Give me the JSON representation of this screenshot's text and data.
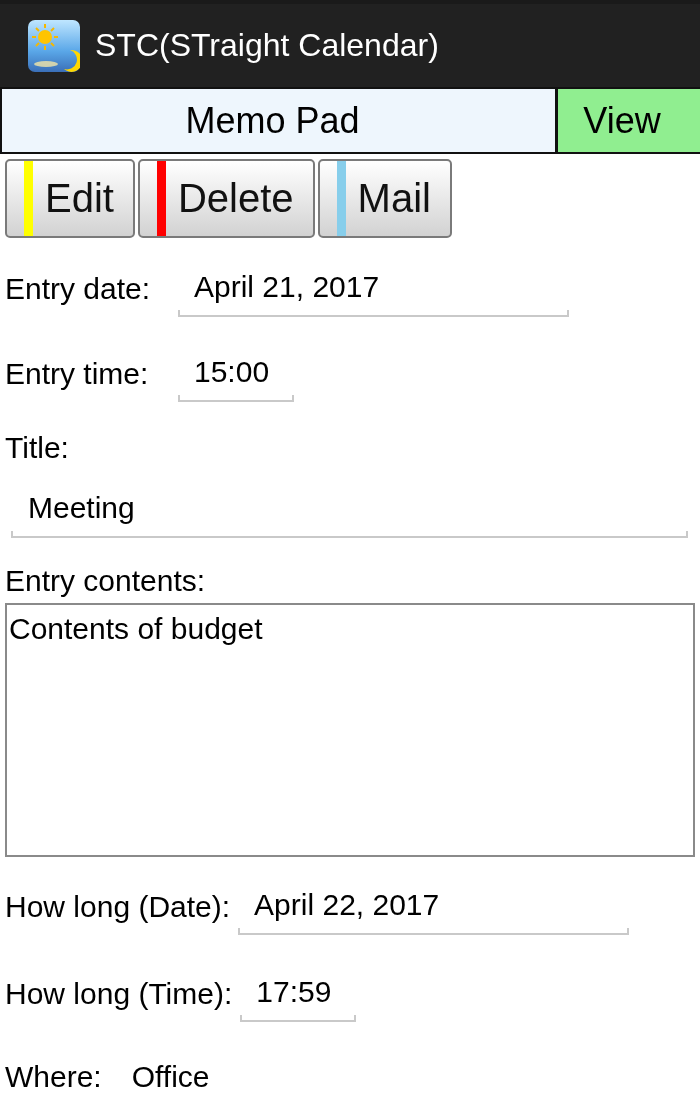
{
  "app_bar": {
    "title": "STC(STraight Calendar)"
  },
  "header": {
    "title": "Memo Pad",
    "view_button": "View"
  },
  "actions": [
    {
      "label": "Edit",
      "color": "#ffff00"
    },
    {
      "label": "Delete",
      "color": "#ff0000"
    },
    {
      "label": "Mail",
      "color": "#87ceeb"
    }
  ],
  "fields": [
    {
      "kind": "date",
      "label": "Entry date:",
      "value": "April 21, 2017"
    },
    {
      "kind": "time",
      "label": "Entry time:",
      "value": "15:00"
    }
  ],
  "title_field": {
    "label": "Title:",
    "value": "Meeting"
  },
  "contents": {
    "label": "Entry contents:",
    "value": "Contents of budget"
  },
  "duration_fields": [
    {
      "kind": "date",
      "label": "How long (Date):",
      "value": "April 22, 2017"
    },
    {
      "kind": "time",
      "label": "How long (Time):",
      "value": "17:59"
    }
  ],
  "where": {
    "label": "Where:",
    "value": "Office"
  }
}
